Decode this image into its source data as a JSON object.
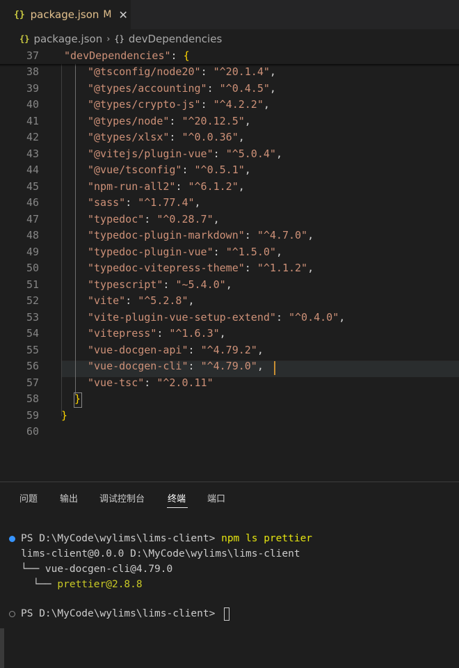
{
  "tab": {
    "icon": "{}",
    "title": "package.json",
    "modified": "M",
    "close": "✕"
  },
  "breadcrumb": {
    "icon1": "{}",
    "file": "package.json",
    "sep": "›",
    "icon2": "{}",
    "section": "devDependencies"
  },
  "editor": {
    "lines": [
      {
        "num": "37",
        "text": "  \"devDependencies\": {"
      },
      {
        "num": "38",
        "key": "\"@tsconfig/node20\"",
        "val": "\"^20.1.4\"",
        "end": ","
      },
      {
        "num": "39",
        "key": "\"@types/accounting\"",
        "val": "\"^0.4.5\"",
        "end": ","
      },
      {
        "num": "40",
        "key": "\"@types/crypto-js\"",
        "val": "\"^4.2.2\"",
        "end": ","
      },
      {
        "num": "41",
        "key": "\"@types/node\"",
        "val": "\"^20.12.5\"",
        "end": ","
      },
      {
        "num": "42",
        "key": "\"@types/xlsx\"",
        "val": "\"^0.0.36\"",
        "end": ","
      },
      {
        "num": "43",
        "key": "\"@vitejs/plugin-vue\"",
        "val": "\"^5.0.4\"",
        "end": ","
      },
      {
        "num": "44",
        "key": "\"@vue/tsconfig\"",
        "val": "\"^0.5.1\"",
        "end": ","
      },
      {
        "num": "45",
        "key": "\"npm-run-all2\"",
        "val": "\"^6.1.2\"",
        "end": ","
      },
      {
        "num": "46",
        "key": "\"sass\"",
        "val": "\"^1.77.4\"",
        "end": ","
      },
      {
        "num": "47",
        "key": "\"typedoc\"",
        "val": "\"^0.28.7\"",
        "end": ","
      },
      {
        "num": "48",
        "key": "\"typedoc-plugin-markdown\"",
        "val": "\"^4.7.0\"",
        "end": ","
      },
      {
        "num": "49",
        "key": "\"typedoc-plugin-vue\"",
        "val": "\"^1.5.0\"",
        "end": ","
      },
      {
        "num": "50",
        "key": "\"typedoc-vitepress-theme\"",
        "val": "\"^1.1.2\"",
        "end": ","
      },
      {
        "num": "51",
        "key": "\"typescript\"",
        "val": "\"~5.4.0\"",
        "end": ","
      },
      {
        "num": "52",
        "key": "\"vite\"",
        "val": "\"^5.2.8\"",
        "end": ","
      },
      {
        "num": "53",
        "key": "\"vite-plugin-vue-setup-extend\"",
        "val": "\"^0.4.0\"",
        "end": ","
      },
      {
        "num": "54",
        "key": "\"vitepress\"",
        "val": "\"^1.6.3\"",
        "end": ","
      },
      {
        "num": "55",
        "key": "\"vue-docgen-api\"",
        "val": "\"^4.79.2\"",
        "end": ","
      },
      {
        "num": "56",
        "key": "\"vue-docgen-cli\"",
        "val": "\"^4.79.0\"",
        "end": ","
      },
      {
        "num": "57",
        "key": "\"vue-tsc\"",
        "val": "\"^2.0.11\"",
        "end": ""
      },
      {
        "num": "58",
        "text": "}"
      },
      {
        "num": "59",
        "text": "}"
      },
      {
        "num": "60",
        "text": ""
      }
    ],
    "line37_key": "\"devDependencies\"",
    "line37_colon": ": ",
    "line37_brace": "{",
    "colon": ": ",
    "line58_brace": "}",
    "line59_brace": "}"
  },
  "panel": {
    "tabs": [
      "问题",
      "输出",
      "调试控制台",
      "终端",
      "端口"
    ],
    "active_tab": "终端"
  },
  "terminal": {
    "prompt1": "PS D:\\MyCode\\wylims\\lims-client> ",
    "cmd1": "npm ls prettier",
    "out1": "lims-client@0.0.0 D:\\MyCode\\wylims\\lims-client",
    "out2_prefix": "└── ",
    "out2": "vue-docgen-cli@4.79.0",
    "out3_prefix": "  └── ",
    "out3": "prettier@2.8.8",
    "prompt2": "PS D:\\MyCode\\wylims\\lims-client> "
  },
  "colors": {
    "key": "#9cdcfe",
    "string": "#ce9178",
    "dot_blue": "#3794ff"
  }
}
